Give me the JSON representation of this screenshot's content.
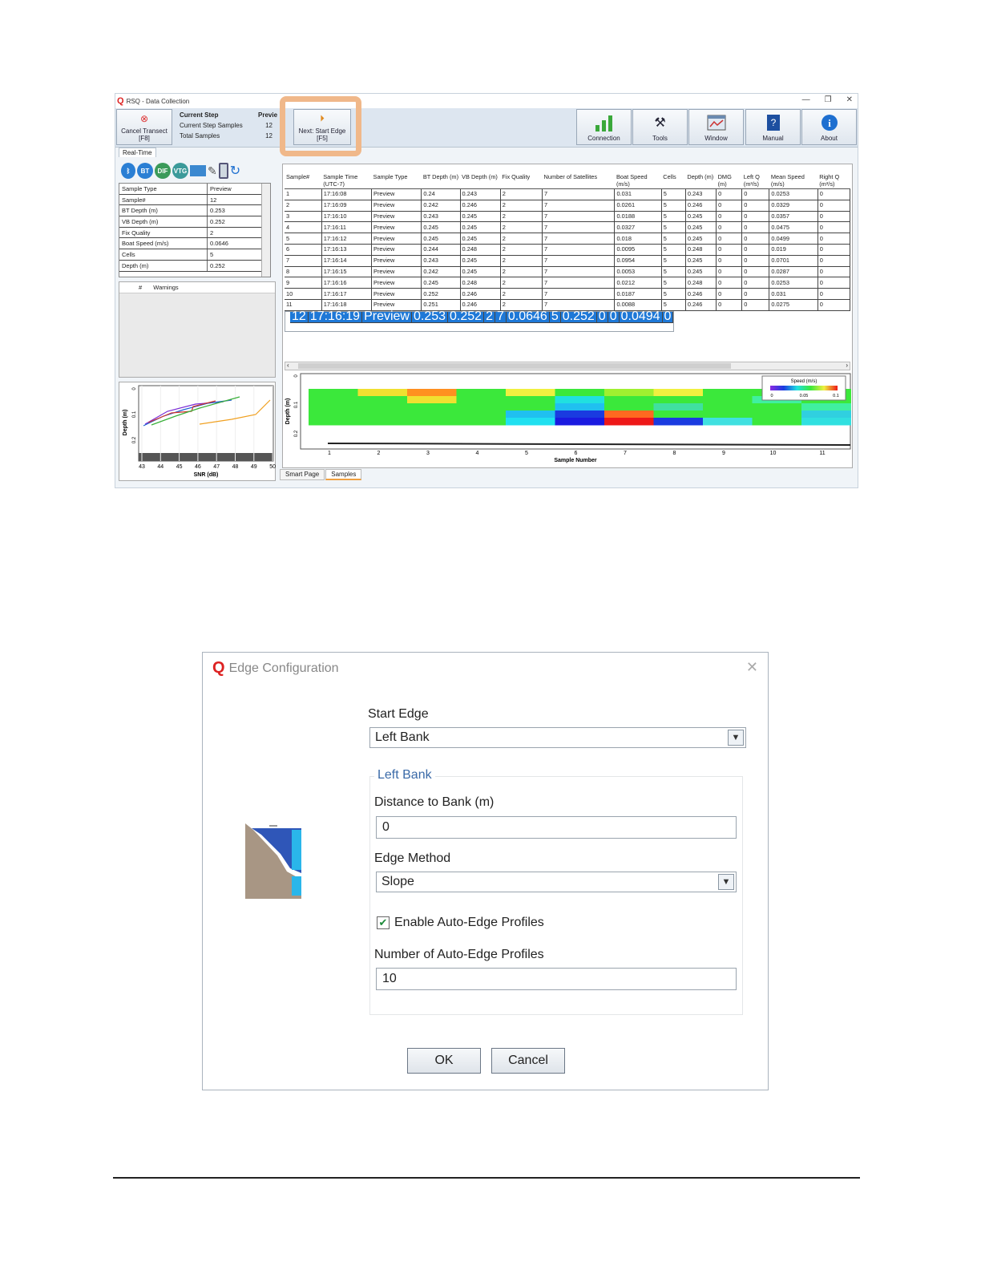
{
  "app": {
    "title": "RSQ - Data Collection",
    "window_buttons": [
      "—",
      "❐",
      "✕"
    ],
    "cancel_button": {
      "label": "Cancel Transect",
      "shortcut": "[F8]"
    },
    "step": {
      "current_step_label": "Current Step",
      "current_step_value": "Previe",
      "current_step_samples_label": "Current Step Samples",
      "current_step_samples_value": "12",
      "total_samples_label": "Total Samples",
      "total_samples_value": "12"
    },
    "next_button": {
      "label": "Next: Start Edge",
      "shortcut": "[F5]"
    },
    "toolbar": {
      "connection": "Connection",
      "tools": "Tools",
      "window": "Window",
      "manual": "Manual",
      "about": "About"
    },
    "realtime_tab": "Real-Time",
    "status_icons": [
      "BT",
      "DIF",
      "VTG"
    ],
    "properties": [
      [
        "Sample Type",
        "Preview"
      ],
      [
        "Sample#",
        "12"
      ],
      [
        "BT Depth (m)",
        "0.253"
      ],
      [
        "VB Depth (m)",
        "0.252"
      ],
      [
        "Fix Quality",
        "2"
      ],
      [
        "Boat Speed (m/s)",
        "0.0646"
      ],
      [
        "Cells",
        "5"
      ],
      [
        "Depth (m)",
        "0.252"
      ]
    ],
    "warnings": {
      "col_num": "#",
      "col_label": "Warnings"
    },
    "snr_chart": {
      "xlabel": "SNR (dB)",
      "ylabel": "Depth (m)",
      "xticks": [
        "43",
        "44",
        "45",
        "46",
        "47",
        "48",
        "49",
        "50"
      ],
      "yticks": [
        "0",
        "0.1",
        "0.2"
      ]
    },
    "table": {
      "headers": [
        "Sample#",
        "Sample Time (UTC-7)",
        "Sample Type",
        "BT Depth (m)",
        "VB Depth (m)",
        "Fix Quality",
        "Number of Satellites",
        "Boat Speed (m/s)",
        "Cells",
        "Depth (m)",
        "DMG (m)",
        "Left Q (m³/s)",
        "Mean Speed (m/s)",
        "Right Q (m³/s)"
      ],
      "rows": [
        [
          "1",
          "17:16:08",
          "Preview",
          "0.24",
          "0.243",
          "2",
          "7",
          "0.031",
          "5",
          "0.243",
          "0",
          "0",
          "0.0253",
          "0"
        ],
        [
          "2",
          "17:16:09",
          "Preview",
          "0.242",
          "0.246",
          "2",
          "7",
          "0.0261",
          "5",
          "0.246",
          "0",
          "0",
          "0.0329",
          "0"
        ],
        [
          "3",
          "17:16:10",
          "Preview",
          "0.243",
          "0.245",
          "2",
          "7",
          "0.0188",
          "5",
          "0.245",
          "0",
          "0",
          "0.0357",
          "0"
        ],
        [
          "4",
          "17:16:11",
          "Preview",
          "0.245",
          "0.245",
          "2",
          "7",
          "0.0327",
          "5",
          "0.245",
          "0",
          "0",
          "0.0475",
          "0"
        ],
        [
          "5",
          "17:16:12",
          "Preview",
          "0.245",
          "0.245",
          "2",
          "7",
          "0.018",
          "5",
          "0.245",
          "0",
          "0",
          "0.0499",
          "0"
        ],
        [
          "6",
          "17:16:13",
          "Preview",
          "0.244",
          "0.248",
          "2",
          "7",
          "0.0095",
          "5",
          "0.248",
          "0",
          "0",
          "0.019",
          "0"
        ],
        [
          "7",
          "17:16:14",
          "Preview",
          "0.243",
          "0.245",
          "2",
          "7",
          "0.0954",
          "5",
          "0.245",
          "0",
          "0",
          "0.0701",
          "0"
        ],
        [
          "8",
          "17:16:15",
          "Preview",
          "0.242",
          "0.245",
          "2",
          "7",
          "0.0053",
          "5",
          "0.245",
          "0",
          "0",
          "0.0287",
          "0"
        ],
        [
          "9",
          "17:16:16",
          "Preview",
          "0.245",
          "0.248",
          "2",
          "7",
          "0.0212",
          "5",
          "0.248",
          "0",
          "0",
          "0.0253",
          "0"
        ],
        [
          "10",
          "17:16:17",
          "Preview",
          "0.252",
          "0.246",
          "2",
          "7",
          "0.0187",
          "5",
          "0.246",
          "0",
          "0",
          "0.031",
          "0"
        ],
        [
          "11",
          "17:16:18",
          "Preview",
          "0.251",
          "0.246",
          "2",
          "7",
          "0.0088",
          "5",
          "0.246",
          "0",
          "0",
          "0.0275",
          "0"
        ],
        [
          "12",
          "17:16:19",
          "Preview",
          "0.253",
          "0.252",
          "2",
          "7",
          "0.0646",
          "5",
          "0.252",
          "0",
          "0",
          "0.0494",
          "0"
        ]
      ],
      "selected_row": 12
    },
    "contour": {
      "ylabel": "Depth (m)",
      "xlabel": "Sample Number",
      "xticks": [
        "1",
        "2",
        "3",
        "4",
        "5",
        "6",
        "7",
        "8",
        "9",
        "10",
        "11"
      ],
      "yticks": [
        "0",
        "0.1",
        "0.2"
      ],
      "legend_title": "Speed (m/s)",
      "legend_ticks": [
        "0",
        "0.05",
        "0.1"
      ]
    },
    "bottom_tabs": [
      "Smart Page",
      "Samples"
    ]
  },
  "dialog": {
    "title": "Edge Configuration",
    "start_edge_label": "Start Edge",
    "start_edge_value": "Left Bank",
    "group_label": "Left Bank",
    "distance_label": "Distance to Bank (m)",
    "distance_value": "0",
    "edge_method_label": "Edge Method",
    "edge_method_value": "Slope",
    "auto_edge_label": "Enable Auto-Edge Profiles",
    "auto_edge_checked": true,
    "num_profiles_label": "Number of Auto-Edge Profiles",
    "num_profiles_value": "10",
    "ok_label": "OK",
    "cancel_label": "Cancel"
  }
}
